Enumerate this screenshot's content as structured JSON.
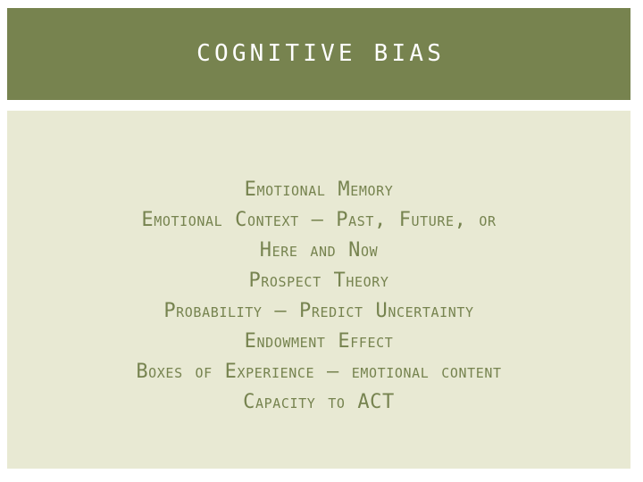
{
  "slide": {
    "title": "Cognitive Bias",
    "theme": {
      "banner_color": "#77834F",
      "body_background_color": "#E8E9D3",
      "title_text_color": "#FFFFFF",
      "body_text_color": "#76834F",
      "page_background_color": "#FFFFFF"
    },
    "body_lines": [
      {
        "text": "Emotional Memory"
      },
      {
        "text": "Emotional Context – Past, Future, or"
      },
      {
        "text": "Here and Now"
      },
      {
        "text": "Prospect Theory"
      },
      {
        "text": "Probability – Predict Uncertainty"
      },
      {
        "text": "Endowment Effect"
      },
      {
        "text": "Boxes of Experience – emotional content"
      },
      {
        "text": "Capacity to ACT"
      }
    ]
  }
}
